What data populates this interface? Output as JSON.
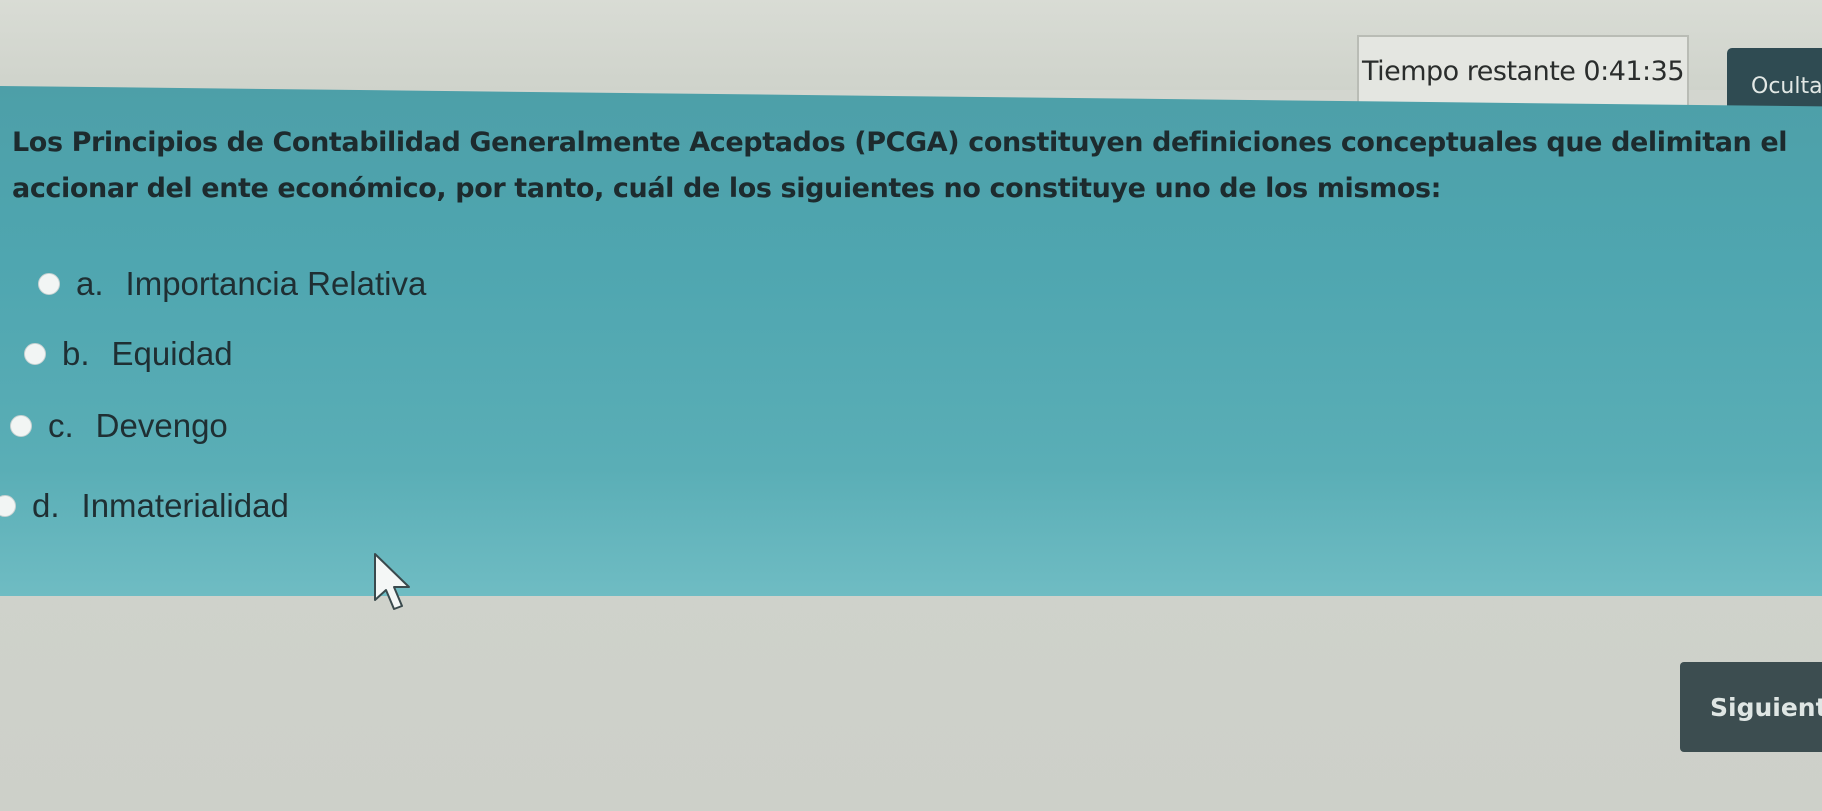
{
  "timer": {
    "label": "Tiempo restante",
    "value": "0:41:35"
  },
  "header": {
    "hide_label": "Oculta"
  },
  "question": {
    "text": "Los Principios de Contabilidad Generalmente Aceptados (PCGA) constituyen definiciones conceptuales que delimitan el accionar del ente económico, por tanto, cuál de los siguientes no constituye uno de los mismos:",
    "options": [
      {
        "letter": "a.",
        "label": "Importancia Relativa"
      },
      {
        "letter": "b.",
        "label": "Equidad"
      },
      {
        "letter": "c.",
        "label": "Devengo"
      },
      {
        "letter": "d.",
        "label": "Inmaterialidad"
      }
    ]
  },
  "footer": {
    "next_label": "Siguient"
  },
  "colors": {
    "panel": "#4fa6b0",
    "background": "#d4d7d0",
    "button": "#3c4d50"
  }
}
